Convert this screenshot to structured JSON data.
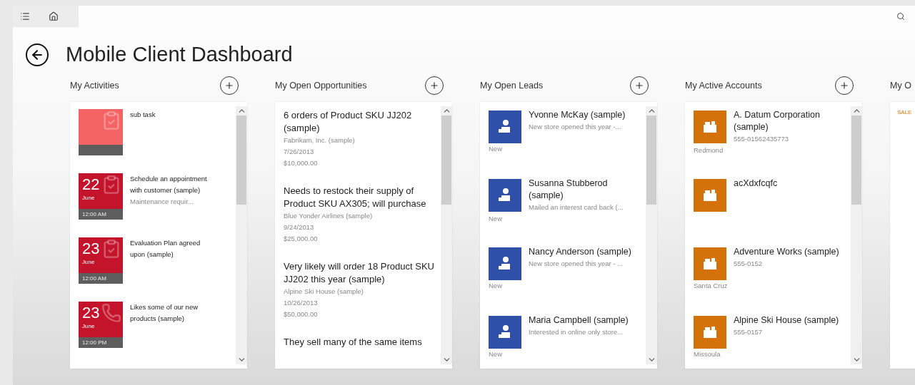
{
  "title": "Mobile Client Dashboard",
  "columns": [
    {
      "kind": "activities",
      "title": "My Activities",
      "items": [
        {
          "kind": "task",
          "lines": [
            "sub task"
          ]
        },
        {
          "kind": "dated",
          "day": "22",
          "month": "June",
          "time": "12:00 AM",
          "lines": [
            "Schedule an appointment with customer (sample)"
          ],
          "detail": "Maintenance requir..."
        },
        {
          "kind": "dated",
          "day": "23",
          "month": "June",
          "time": "12:00 AM",
          "lines": [
            "Evaluation Plan agreed upon (sample)"
          ]
        },
        {
          "kind": "call",
          "day": "23",
          "month": "June",
          "time": "12:00 PM",
          "lines": [
            "Likes some of our new products (sample)"
          ]
        }
      ]
    },
    {
      "kind": "opportunities",
      "title": "My Open Opportunities",
      "items": [
        {
          "name": "6 orders of Product SKU JJ202 (sample)",
          "account": "Fabrikam, Inc. (sample)",
          "date": "7/26/2013",
          "amount": "$10,000.00"
        },
        {
          "name": "Needs to restock their supply of Product SKU AX305; will purchase",
          "account": "Blue Yonder Airlines (sample)",
          "date": "9/24/2013",
          "amount": "$25,000.00"
        },
        {
          "name": "Very likely will order 18 Product SKU JJ202 this year (sample)",
          "account": "Alpine Ski House (sample)",
          "date": "10/26/2013",
          "amount": "$50,000.00"
        },
        {
          "name": "They sell many of the same items"
        }
      ]
    },
    {
      "kind": "leads",
      "title": "My Open Leads",
      "items": [
        {
          "name": "Yvonne McKay (sample)",
          "detail": "New store opened this year -...",
          "status": "New"
        },
        {
          "name": "Susanna Stubberod (sample)",
          "detail": "Mailed an interest card back (...",
          "status": "New"
        },
        {
          "name": "Nancy Anderson (sample)",
          "detail": "New store opened this year - ...",
          "status": "New"
        },
        {
          "name": "Maria Campbell (sample)",
          "detail": "Interested in online only store...",
          "status": "New"
        }
      ]
    },
    {
      "kind": "accounts",
      "title": "My Active Accounts",
      "items": [
        {
          "name": "A. Datum Corporation (sample)",
          "detail": "555-01562435773",
          "status": "Redmond"
        },
        {
          "name": "acXdxfcqfc"
        },
        {
          "name": "Adventure Works (sample)",
          "detail": "555-0152",
          "status": "Santa Cruz"
        },
        {
          "name": "Alpine Ski House (sample)",
          "detail": "555-0157",
          "status": "Missoula"
        }
      ]
    },
    {
      "kind": "partial",
      "title": "My O",
      "label": "SALE"
    }
  ]
}
